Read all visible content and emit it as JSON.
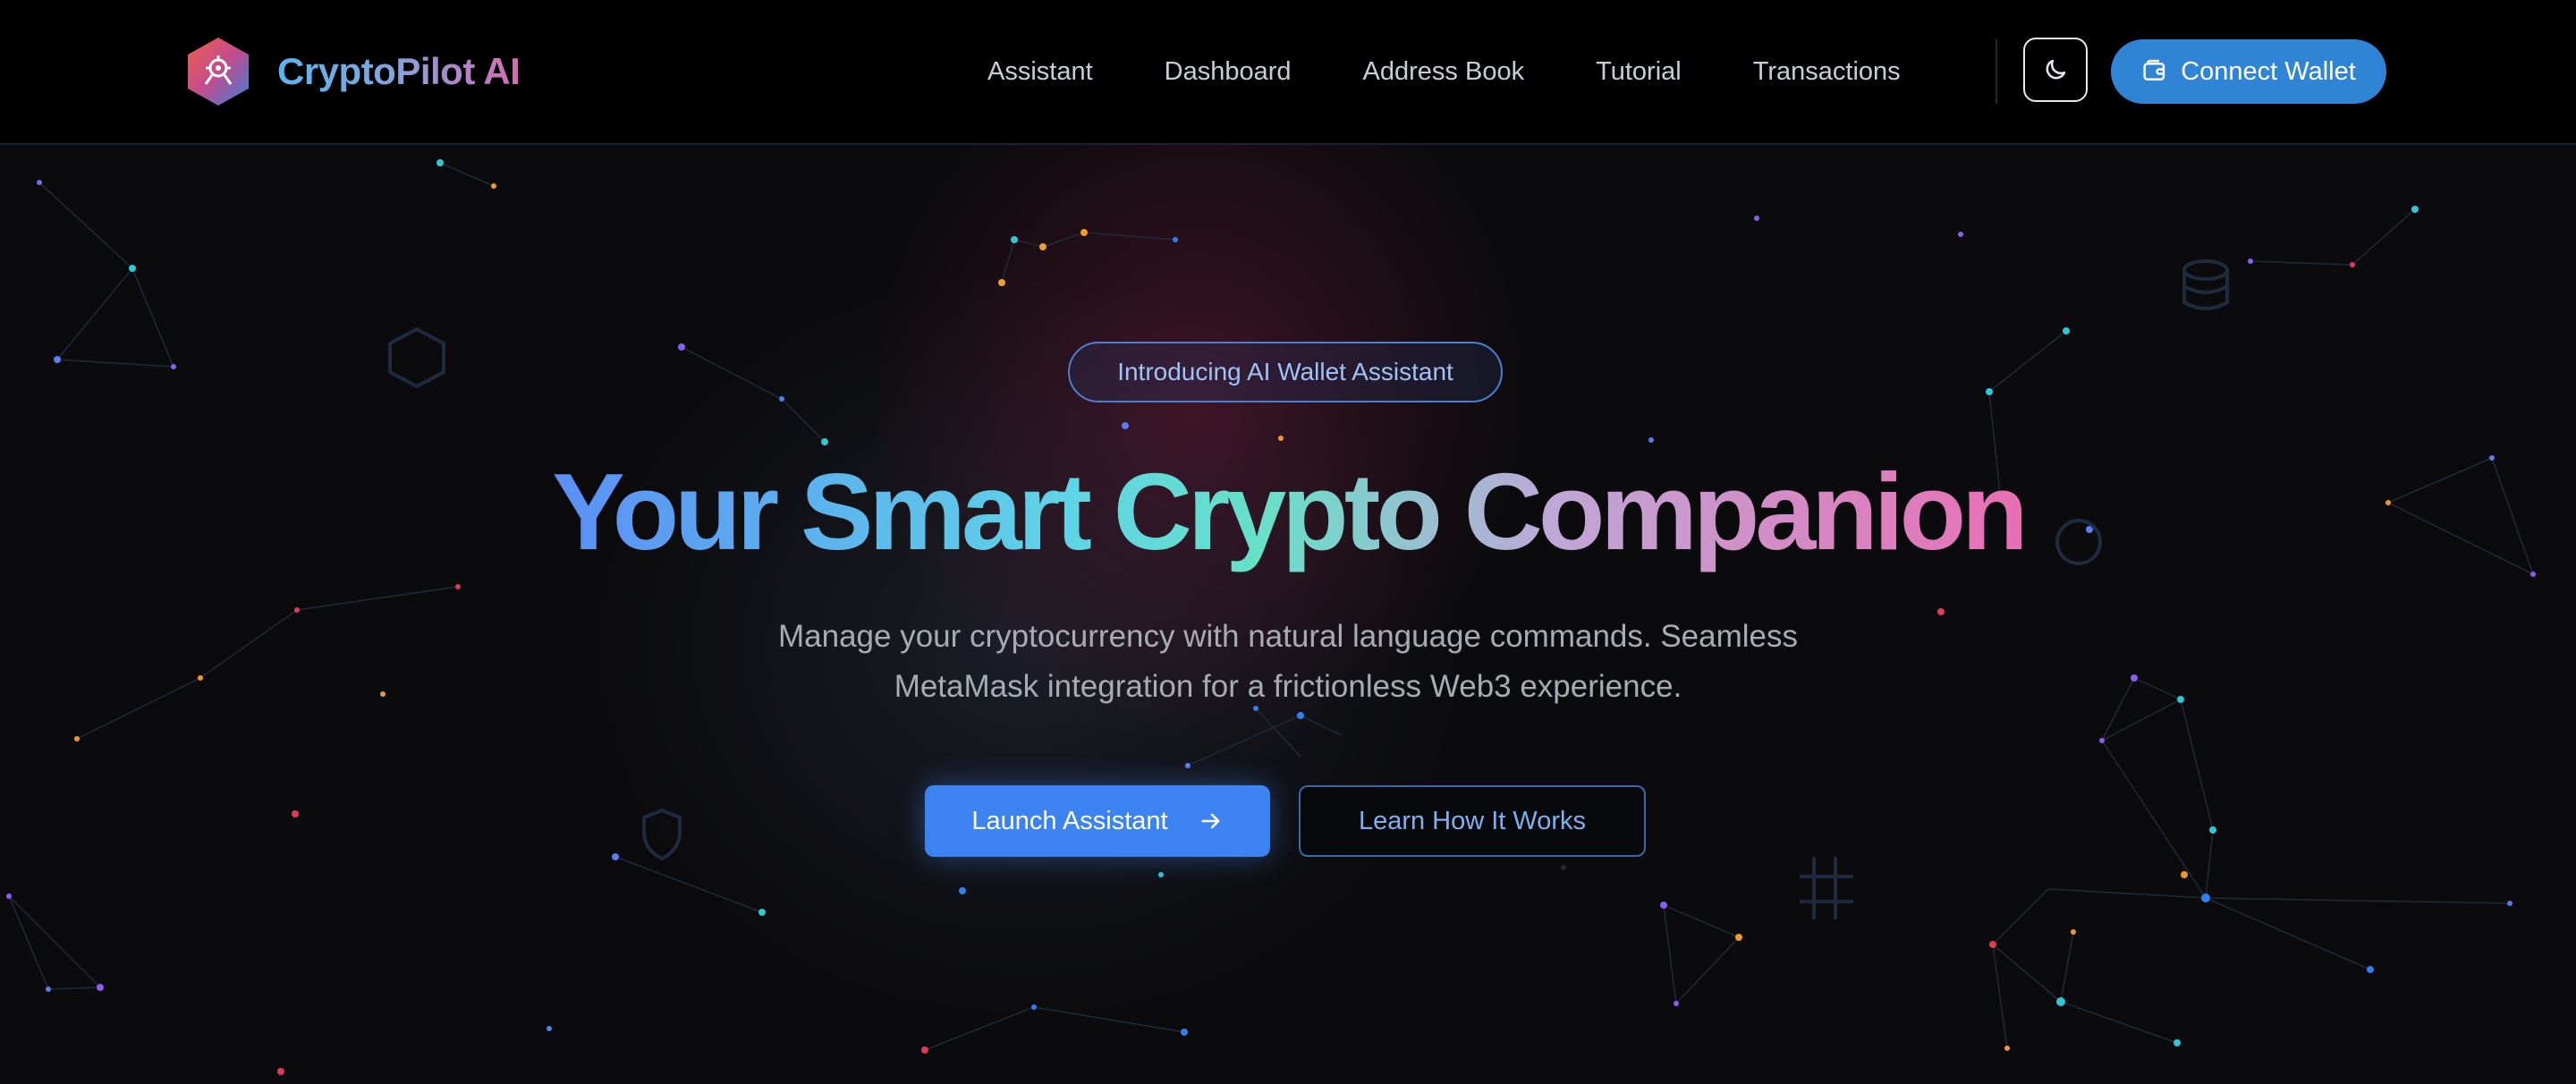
{
  "brand": {
    "name": "CryptoPilot AI"
  },
  "nav": {
    "links": [
      "Assistant",
      "Dashboard",
      "Address Book",
      "Tutorial",
      "Transactions"
    ],
    "theme_toggle_icon": "moon-icon",
    "connect_wallet_label": "Connect Wallet",
    "connect_wallet_icon": "wallet-icon"
  },
  "hero": {
    "badge": "Introducing AI Wallet Assistant",
    "title": "Your Smart Crypto Companion",
    "subtitle_line1": "Manage your cryptocurrency with natural language commands. Seamless",
    "subtitle_line2": "MetaMask integration for a frictionless Web3 experience.",
    "primary_cta": "Launch Assistant",
    "primary_cta_icon": "arrow-right-icon",
    "secondary_cta": "Learn How It Works"
  },
  "colors": {
    "background": "#0b0b0d",
    "navbar": "#000000",
    "accent_blue": "#3c82f0",
    "connect_button": "#2f84d6",
    "brand_gradient": [
      "#5ab4f0",
      "#d86bb5"
    ],
    "title_gradient": [
      "#5b8ff5",
      "#5fd4e6",
      "#67e0c8",
      "#bfa7d6",
      "#e86fb4"
    ],
    "subtitle": "#a7abb3"
  }
}
